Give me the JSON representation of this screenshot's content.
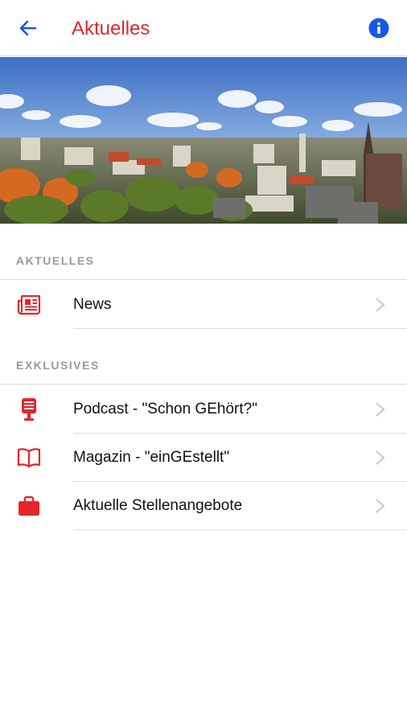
{
  "nav": {
    "title": "Aktuelles",
    "back_icon": "arrow-left-icon",
    "info_icon": "info-circle-icon"
  },
  "colors": {
    "accent": "#e3262b",
    "blue": "#1a56e8",
    "header_text": "#9a9a9a"
  },
  "sections": [
    {
      "header": "AKTUELLES",
      "items": [
        {
          "label": "News",
          "icon": "newspaper-icon"
        }
      ]
    },
    {
      "header": "EXKLUSIVES",
      "items": [
        {
          "label": "Podcast - \"Schon GEhört?\"",
          "icon": "microphone-icon"
        },
        {
          "label": "Magazin - \"einGEstellt\"",
          "icon": "open-book-icon"
        },
        {
          "label": "Aktuelle Stellenangebote",
          "icon": "briefcase-icon"
        }
      ]
    }
  ]
}
